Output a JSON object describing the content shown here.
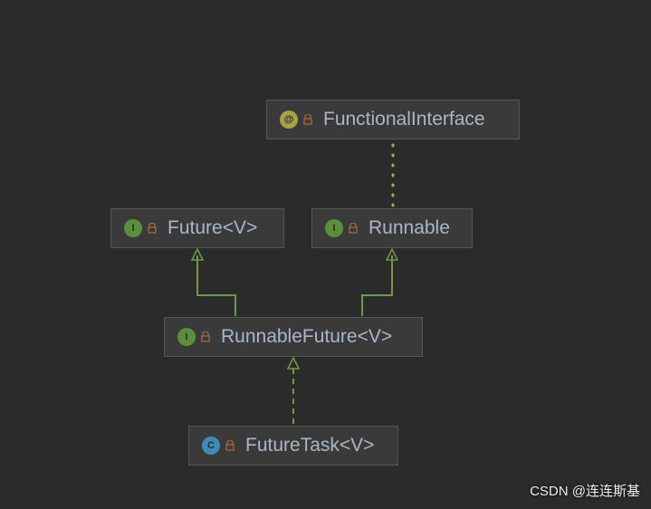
{
  "diagram": {
    "nodes": {
      "functionalInterface": {
        "label": "FunctionalInterface",
        "kind": "annotation",
        "kindLetter": "@"
      },
      "future": {
        "label": "Future<V>",
        "kind": "interface",
        "kindLetter": "I"
      },
      "runnable": {
        "label": "Runnable",
        "kind": "interface",
        "kindLetter": "I"
      },
      "runnableFuture": {
        "label": "RunnableFuture<V>",
        "kind": "interface",
        "kindLetter": "I"
      },
      "futureTask": {
        "label": "FutureTask<V>",
        "kind": "class",
        "kindLetter": "C"
      }
    },
    "edges": [
      {
        "from": "runnable",
        "to": "functionalInterface",
        "style": "dotted"
      },
      {
        "from": "runnableFuture",
        "to": "future",
        "style": "solid"
      },
      {
        "from": "runnableFuture",
        "to": "runnable",
        "style": "solid"
      },
      {
        "from": "futureTask",
        "to": "runnableFuture",
        "style": "dashed"
      }
    ]
  },
  "watermark": "CSDN @连连斯基"
}
